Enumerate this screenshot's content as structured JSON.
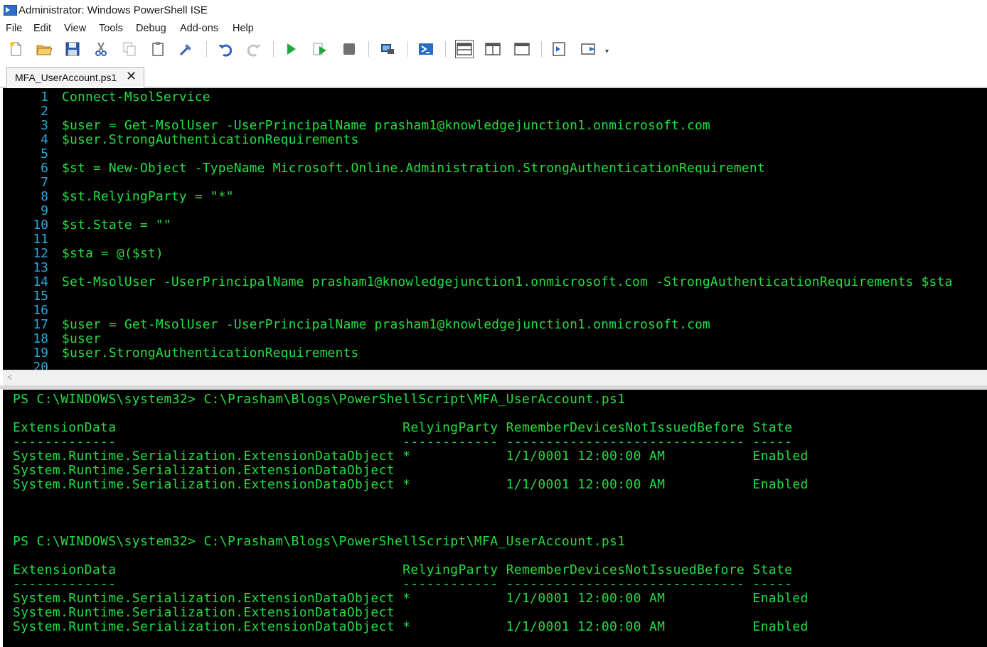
{
  "window": {
    "title": "Administrator: Windows PowerShell ISE"
  },
  "menu": [
    "File",
    "Edit",
    "View",
    "Tools",
    "Debug",
    "Add-ons",
    "Help"
  ],
  "toolbar": {
    "icons": [
      "new-script-icon",
      "open-icon",
      "save-icon",
      "cut-icon",
      "copy-icon",
      "paste-icon",
      "clear-console-icon",
      "undo-icon",
      "redo-icon",
      "run-script-icon",
      "run-selection-icon",
      "stop-icon",
      "new-remote-tab-icon",
      "powershell-icon",
      "layout-split-top-icon",
      "layout-split-right-icon",
      "layout-maximize-icon",
      "show-script-pane-icon",
      "show-commands-icon",
      "toolbar-overflow-icon"
    ]
  },
  "tab": {
    "label": "MFA_UserAccount.ps1",
    "close": "✕"
  },
  "editor": {
    "lines": [
      {
        "n": "1",
        "t": "Connect-MsolService"
      },
      {
        "n": "2",
        "t": ""
      },
      {
        "n": "3",
        "t": "$user = Get-MsolUser -UserPrincipalName prasham1@knowledgejunction1.onmicrosoft.com"
      },
      {
        "n": "4",
        "t": "$user.StrongAuthenticationRequirements"
      },
      {
        "n": "5",
        "t": ""
      },
      {
        "n": "6",
        "t": "$st = New-Object -TypeName Microsoft.Online.Administration.StrongAuthenticationRequirement"
      },
      {
        "n": "7",
        "t": ""
      },
      {
        "n": "8",
        "t": "$st.RelyingParty = \"*\""
      },
      {
        "n": "9",
        "t": ""
      },
      {
        "n": "10",
        "t": "$st.State = \"\""
      },
      {
        "n": "11",
        "t": ""
      },
      {
        "n": "12",
        "t": "$sta = @($st)"
      },
      {
        "n": "13",
        "t": ""
      },
      {
        "n": "14",
        "t": "Set-MsolUser -UserPrincipalName prasham1@knowledgejunction1.onmicrosoft.com -StrongAuthenticationRequirements $sta"
      },
      {
        "n": "15",
        "t": ""
      },
      {
        "n": "16",
        "t": ""
      },
      {
        "n": "17",
        "t": "$user = Get-MsolUser -UserPrincipalName prasham1@knowledgejunction1.onmicrosoft.com"
      },
      {
        "n": "18",
        "t": "$user"
      },
      {
        "n": "19",
        "t": "$user.StrongAuthenticationRequirements"
      },
      {
        "n": "20",
        "t": ""
      }
    ]
  },
  "scroll": {
    "left_arrow": "<"
  },
  "console": {
    "lines": [
      "PS C:\\WINDOWS\\system32> C:\\Prasham\\Blogs\\PowerShellScript\\MFA_UserAccount.ps1",
      "",
      "ExtensionData                                    RelyingParty RememberDevicesNotIssuedBefore State",
      "-------------                                    ------------ ------------------------------ -----",
      "System.Runtime.Serialization.ExtensionDataObject *            1/1/0001 12:00:00 AM           Enabled",
      "System.Runtime.Serialization.ExtensionDataObject",
      "System.Runtime.Serialization.ExtensionDataObject *            1/1/0001 12:00:00 AM           Enabled",
      "",
      "",
      "",
      "PS C:\\WINDOWS\\system32> C:\\Prasham\\Blogs\\PowerShellScript\\MFA_UserAccount.ps1",
      "",
      "ExtensionData                                    RelyingParty RememberDevicesNotIssuedBefore State",
      "-------------                                    ------------ ------------------------------ -----",
      "System.Runtime.Serialization.ExtensionDataObject *            1/1/0001 12:00:00 AM           Enabled",
      "System.Runtime.Serialization.ExtensionDataObject",
      "System.Runtime.Serialization.ExtensionDataObject *            1/1/0001 12:00:00 AM           Enabled"
    ]
  },
  "colors": {
    "code": "#23dd42",
    "line_numbers": "#2aa6d9",
    "pane_bg": "#000000"
  }
}
